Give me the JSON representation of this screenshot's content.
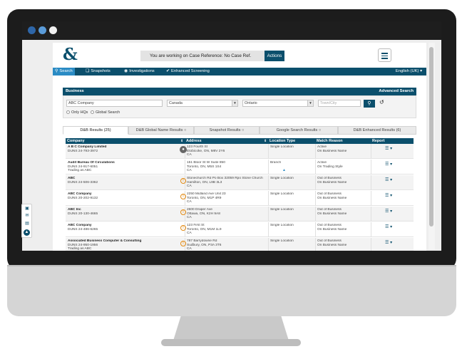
{
  "header": {
    "logo_text": "&",
    "case_reference": "You are working on Case Reference: No Case Ref.",
    "actions_label": "Actions"
  },
  "nav": {
    "items": [
      {
        "label": "Search",
        "icon": "search-icon"
      },
      {
        "label": "Snapshots",
        "icon": "snapshot-icon"
      },
      {
        "label": "Investigations",
        "icon": "eye-icon"
      },
      {
        "label": "Enhanced Screening",
        "icon": "check-circle-icon"
      }
    ],
    "language": "English (UK)"
  },
  "search": {
    "section_title": "Business",
    "advanced_label": "Advanced Search",
    "company_value": "ABC Company",
    "country_value": "Canada",
    "province_value": "Ontario",
    "city_placeholder": "Town/City",
    "only_hqs_label": "Only HQs",
    "global_search_label": "Global Search"
  },
  "tabs": [
    {
      "label": "D&B Results (25)",
      "active": true
    },
    {
      "label": "D&B Global Name Results",
      "active": false
    },
    {
      "label": "Snapshot Results",
      "active": false
    },
    {
      "label": "Google Search Results",
      "active": false
    },
    {
      "label": "D&B Enhanced Results (6)",
      "active": false
    }
  ],
  "table": {
    "columns": [
      "Company",
      "Address",
      "Location Type",
      "Match Reason",
      "Report"
    ],
    "rows": [
      {
        "name": "A B C Company Limited",
        "duns": "DUNS 24-793-3972",
        "extra": "",
        "address": [
          "123 Fourth St",
          "Etobicoke, ON, M8V 2Y6",
          "CA"
        ],
        "location": "Single Location",
        "match": [
          "Active",
          "On Business Name"
        ],
        "status_icon": "globe-icon"
      },
      {
        "name": "Audit Bureau Of Circulations",
        "duns": "DUNS 24-917-6051",
        "extra": "Trading as ABC",
        "address": [
          "151 Bloor St W Suite 850",
          "Toronto, ON, M5S 1S4",
          "CA"
        ],
        "location": "Branch",
        "match": [
          "Active",
          "On Trading Style"
        ],
        "status_icon": ""
      },
      {
        "name": "ABC",
        "duns": "DUNS 24-506-3362",
        "extra": "",
        "address": [
          "Stonechurch Rd Po Box 32059 Rpo Stone Church",
          "Hamilton, ON, L9B 3L3",
          "CA"
        ],
        "location": "Single Location",
        "match": [
          "Out of Business",
          "On Business Name"
        ],
        "status_icon": "warning-icon"
      },
      {
        "name": "ABC Company",
        "duns": "DUNS 20-202-9132",
        "extra": "",
        "address": [
          "2250 Midland Ave Unit 23",
          "Toronto, ON, M1P 4R9",
          "CA"
        ],
        "location": "Single Location",
        "match": [
          "Out of Business",
          "On Business Name"
        ],
        "status_icon": "warning-icon"
      },
      {
        "name": "ABC Inc",
        "duns": "DUNS 20-130-4665",
        "extra": "",
        "address": [
          "2600 Draper Ave",
          "Ottawa, ON, K2H 9A8",
          "CA"
        ],
        "location": "Single Location",
        "match": [
          "Out of Business",
          "On Business Name"
        ],
        "status_icon": "warning-icon"
      },
      {
        "name": "ABC Company",
        "duns": "DUNS 24-486-6265",
        "extra": "",
        "address": [
          "123 First St",
          "Toronto, ON, M1M 1L9",
          "CA"
        ],
        "location": "Single Location",
        "match": [
          "Out of Business",
          "On Business Name"
        ],
        "status_icon": "warning-icon"
      },
      {
        "name": "Associated Business Computer & Consulting",
        "duns": "DUNS 24-950-1956",
        "extra": "Trading as ABC",
        "address": [
          "787 Barrydowne Rd",
          "Sudbury, ON, P3A 3T6",
          "CA"
        ],
        "location": "Single Location",
        "match": [
          "Out of Business",
          "On Business Name"
        ],
        "status_icon": "warning-icon"
      }
    ]
  },
  "colors": {
    "brand": "#0b4f6c",
    "accent": "#2a8bc4",
    "warning": "#e38a12"
  }
}
